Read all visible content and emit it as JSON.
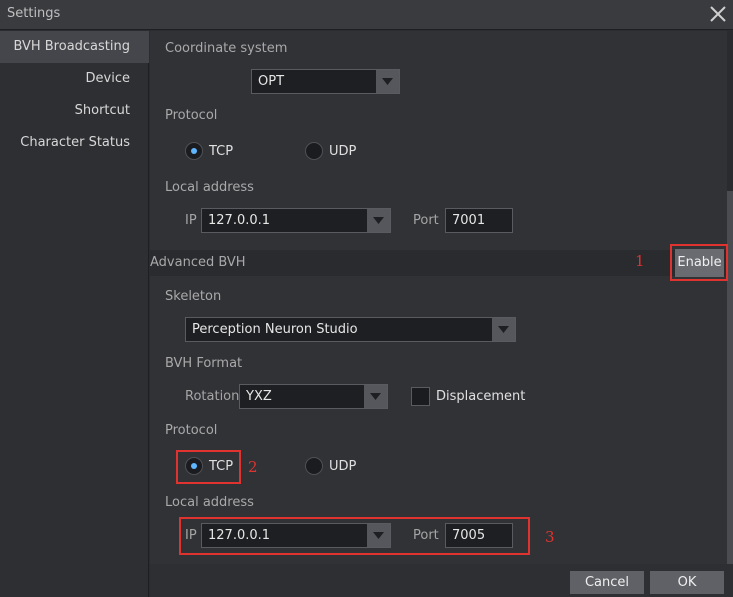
{
  "window": {
    "title": "Settings"
  },
  "sidebar": {
    "items": [
      {
        "label": "BVH Broadcasting"
      },
      {
        "label": "Device"
      },
      {
        "label": "Shortcut"
      },
      {
        "label": "Character Status"
      }
    ]
  },
  "general": {
    "coordinate_label": "Coordinate system",
    "coordinate_value": "OPT",
    "protocol_label": "Protocol",
    "tcp_label": "TCP",
    "udp_label": "UDP",
    "local_address_label": "Local address",
    "ip_label": "IP",
    "ip_value": "127.0.0.1",
    "port_label": "Port",
    "port_value": "7001"
  },
  "advanced": {
    "section_title": "Advanced BVH",
    "enable_label": "Enable",
    "skeleton_label": "Skeleton",
    "skeleton_value": "Perception Neuron Studio",
    "bvh_format_label": "BVH Format",
    "rotation_label": "Rotation",
    "rotation_value": "YXZ",
    "displacement_label": "Displacement",
    "protocol_label": "Protocol",
    "tcp_label": "TCP",
    "udp_label": "UDP",
    "local_address_label": "Local address",
    "ip_label": "IP",
    "ip_value": "127.0.0.1",
    "port_label": "Port",
    "port_value": "7005"
  },
  "annotations": [
    "1",
    "2",
    "3"
  ],
  "footer": {
    "cancel_label": "Cancel",
    "ok_label": "OK"
  },
  "colors": {
    "annotation": "#e0332f",
    "radio_selected": "#5fb6ff"
  }
}
